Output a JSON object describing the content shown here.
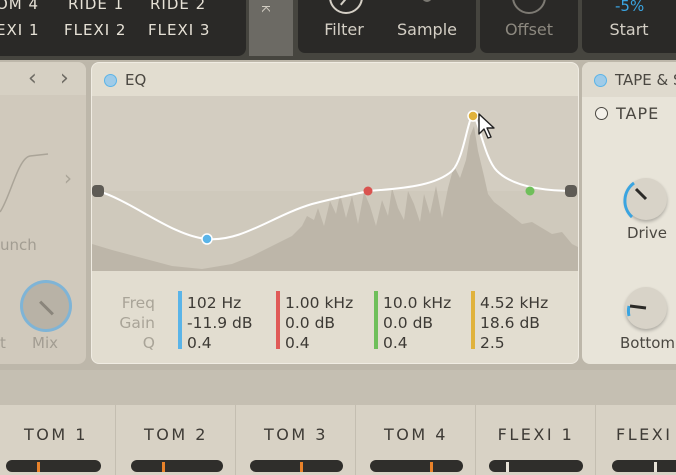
{
  "top": {
    "pads_row1": [
      "OM 4",
      "RIDE 1",
      "RIDE 2"
    ],
    "pads_row2": [
      "EXI 1",
      "FLEXI 2",
      "FLEXI 3"
    ],
    "k_label": "K",
    "controls": {
      "filter": "Filter",
      "sample": "Sample",
      "offset": "Offset",
      "start": "Start",
      "start_value": "-5%"
    }
  },
  "left_panel": {
    "prev": "‹",
    "next": "›",
    "expand": "›",
    "punch_label": "unch",
    "t_label": "t",
    "mix_label": "Mix"
  },
  "eq": {
    "title": "EQ",
    "row_labels": [
      "Freq",
      "Gain",
      "Q"
    ],
    "bands": [
      {
        "freq": "102 Hz",
        "gain": "-11.9 dB",
        "q": "0.4",
        "color": "#5ab4e8"
      },
      {
        "freq": "1.00 kHz",
        "gain": "0.0 dB",
        "q": "0.4",
        "color": "#e05a57"
      },
      {
        "freq": "10.0 kHz",
        "gain": "0.0 dB",
        "q": "0.4",
        "color": "#6fbf5a"
      },
      {
        "freq": "4.52 kHz",
        "gain": "18.6 dB",
        "q": "2.5",
        "color": "#e0b23c"
      }
    ]
  },
  "tape": {
    "header": "TAPE & S",
    "tape_label": "TAPE",
    "drive_label": "Drive",
    "bottom_label": "Bottom"
  },
  "bottom_slots": [
    "TOM 1",
    "TOM 2",
    "TOM 3",
    "TOM 4",
    "FLEXI 1",
    "FLEXI"
  ],
  "colors": {
    "accent_blue": "#3aa4e0",
    "slot_marker": "#e8822a",
    "flexi_marker": "#e6e1d6"
  }
}
